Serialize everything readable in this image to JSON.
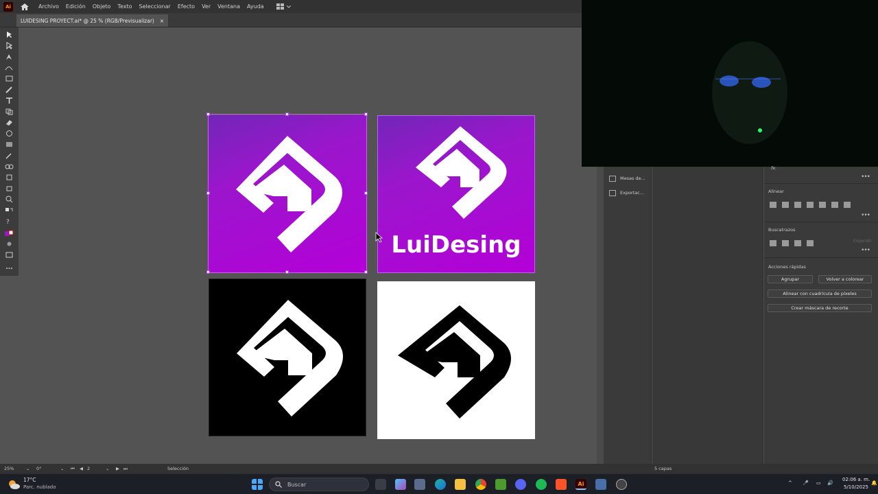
{
  "app": {
    "logo_text": "Ai",
    "menu": [
      "Archivo",
      "Edición",
      "Objeto",
      "Texto",
      "Seleccionar",
      "Efecto",
      "Ver",
      "Ventana",
      "Ayuda"
    ]
  },
  "document_tab": {
    "title": "LUIDESING PROYECT.ai* @ 25 % (RGB/Previsualizar)",
    "close": "×"
  },
  "artboards": {
    "brand_text": "LuiDesing",
    "colors": {
      "purple_start": "#7226b8",
      "purple_end": "#b400d8",
      "black": "#000000",
      "white": "#ffffff"
    }
  },
  "panels": {
    "left_column": [
      "Mesas de...",
      "Exportac..."
    ],
    "fx_label": "fx.",
    "align_title": "Alinear",
    "pathfinder_title": "Buscatrazos",
    "expand_label": "Expandir",
    "quick_actions_title": "Acciones rápidas",
    "buttons": {
      "group": "Agrupar",
      "recolor": "Volver a colorear",
      "align_pixel": "Alinear con cuadrícula de píxeles",
      "clip_mask": "Crear máscara de recorte"
    },
    "layers_count": "5 capas"
  },
  "status": {
    "zoom": "25%",
    "rotation": "0°",
    "artboard_number": "2",
    "tool": "Selección"
  },
  "taskbar": {
    "weather_temp": "17°C",
    "weather_desc": "Parc. nublado",
    "search_placeholder": "Buscar",
    "time": "02:06 a. m.",
    "date": "5/10/2025"
  }
}
